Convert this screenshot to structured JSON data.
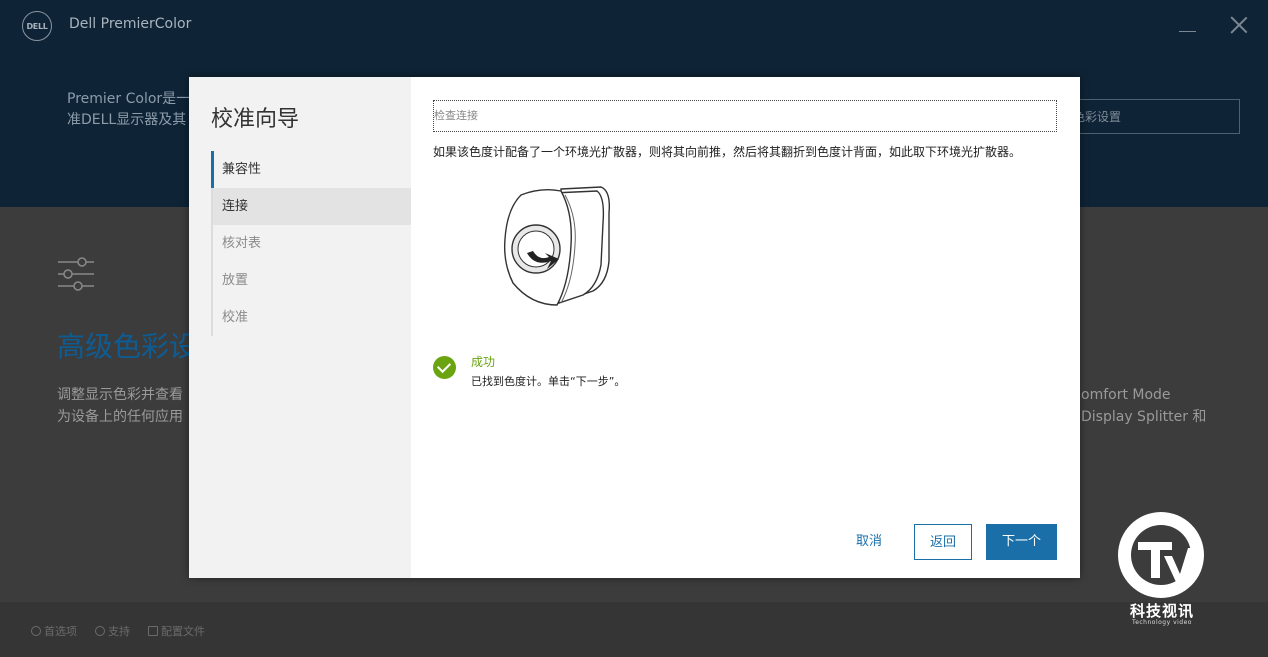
{
  "app": {
    "title": "Dell PremierColor",
    "logo_text": "DELL",
    "header_description": "Premier Color是一\n准DELL显示器及其",
    "header_button": "色彩设置",
    "advanced_title": "高级色彩设",
    "advanced_desc": "调整显示色彩并查看\n为设备上的任何应用",
    "right_desc": "omfort Mode\nDisplay Splitter 和",
    "footer": [
      {
        "label": "首选项",
        "icon": "gear-icon"
      },
      {
        "label": "支持",
        "icon": "wrench-icon"
      },
      {
        "label": "配置文件",
        "icon": "profile-icon"
      }
    ]
  },
  "dialog": {
    "title": "校准向导",
    "steps": [
      {
        "label": "兼容性",
        "state": "done"
      },
      {
        "label": "连接",
        "state": "active"
      },
      {
        "label": "核对表",
        "state": "pending"
      },
      {
        "label": "放置",
        "state": "pending"
      },
      {
        "label": "校准",
        "state": "pending"
      }
    ],
    "section_header": "检查连接",
    "instruction": "如果该色度计配备了一个环境光扩散器，则将其向前推，然后将其翻折到色度计背面，如此取下环境光扩散器。",
    "status": {
      "title": "成功",
      "message": "已找到色度计。单击“下一步”。",
      "color": "#6aa411"
    },
    "buttons": {
      "cancel": "取消",
      "back": "返回",
      "next": "下一个"
    },
    "accent_color": "#1a6fa8"
  },
  "watermark": {
    "logo": "TV",
    "text": "科技视讯",
    "sub": "Technology video"
  }
}
